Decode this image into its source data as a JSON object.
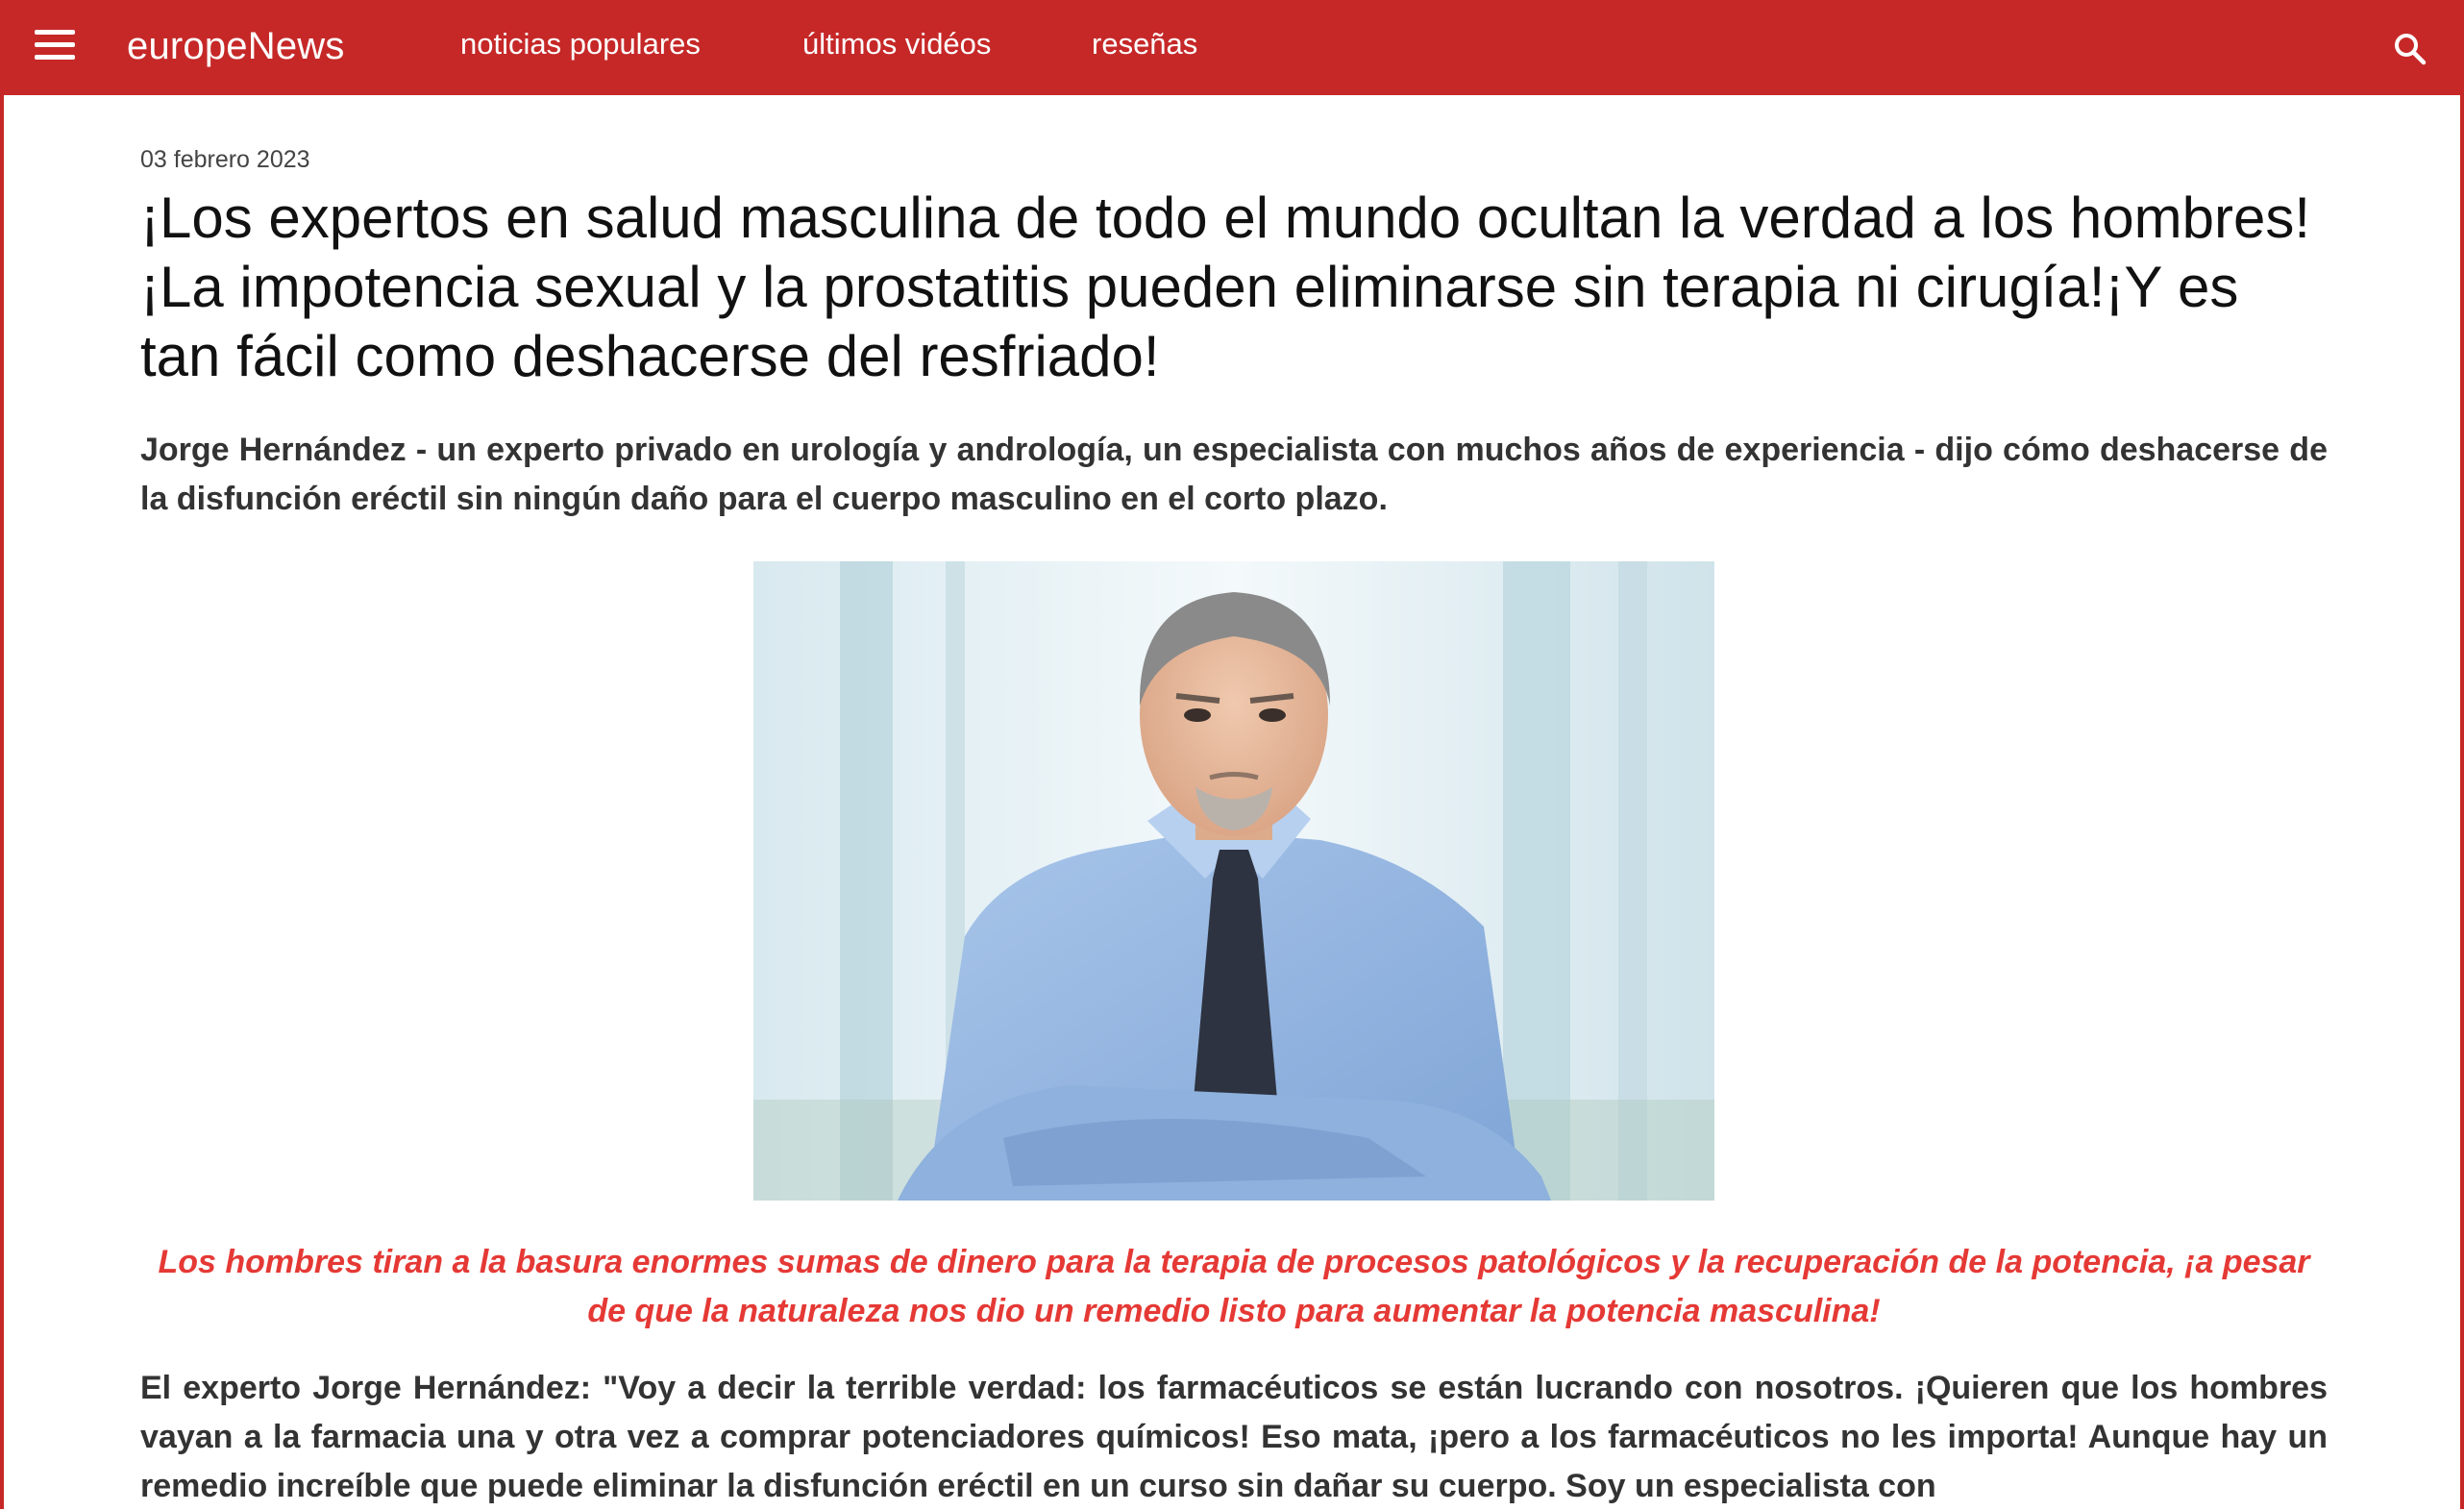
{
  "header": {
    "brand": "europeNews",
    "nav": [
      {
        "label": "noticias populares"
      },
      {
        "label": "últimos vidéos"
      },
      {
        "label": "reseñas"
      }
    ],
    "accent_color": "#c62828",
    "icons": {
      "menu": "hamburger-menu-icon",
      "search": "search-icon"
    }
  },
  "article": {
    "date": "03 febrero 2023",
    "headline": "¡Los expertos en salud masculina de todo el mundo ocultan la verdad a los hombres!¡La impotencia sexual y la prostatitis pueden eliminarse sin terapia ni cirugía!¡Y es tan fácil como deshacerse del resfriado!",
    "lead": "Jorge Hernández - un experto privado en urología y andrología, un especialista con muchos años de experiencia - dijo cómo deshacerse de la disfunción eréctil sin ningún daño para el cuerpo masculino en el corto plazo.",
    "callout": "Los hombres tiran a la basura enormes sumas de dinero para la terapia de procesos patológicos y la recuperación de la potencia, ¡a pesar de que la naturaleza nos dio un remedio listo para aumentar la potencia masculina!",
    "callout_color": "#e53935",
    "body": "El experto Jorge Hernández: \"Voy a decir la terrible verdad: los farmacéuticos se están lucrando con nosotros. ¡Quieren que los hombres vayan a la farmacia una y otra vez a comprar potenciadores químicos! Eso mata, ¡pero a los farmacéuticos no les importa! Aunque hay un remedio increíble que puede eliminar la disfunción eréctil en un curso sin dañar su cuerpo. Soy un especialista con"
  }
}
